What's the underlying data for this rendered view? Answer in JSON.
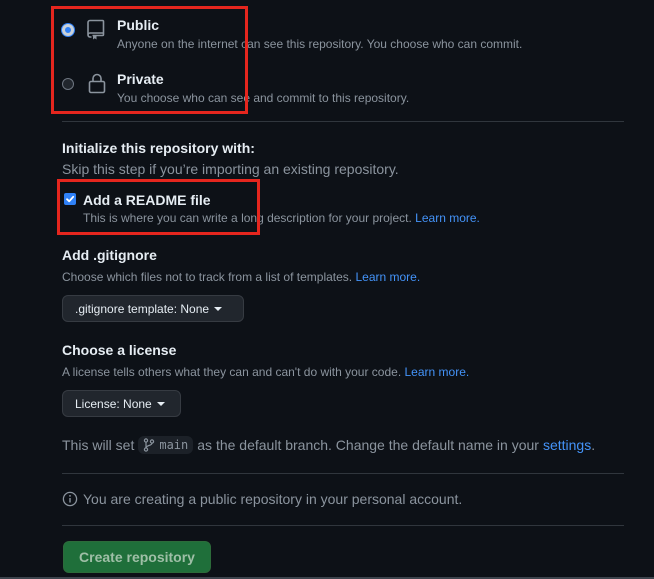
{
  "visibility": {
    "options": [
      {
        "title": "Public",
        "desc": "Anyone on the internet can see this repository. You choose who can commit.",
        "checked": true,
        "icon": "repo-icon"
      },
      {
        "title": "Private",
        "desc": "You choose who can see and commit to this repository.",
        "checked": false,
        "icon": "lock-icon"
      }
    ]
  },
  "init": {
    "title": "Initialize this repository with:",
    "desc": "Skip this step if you’re importing an existing repository.",
    "readme": {
      "label": "Add a README file",
      "desc": "This is where you can write a long description for your project.",
      "link": "Learn more.",
      "checked": true
    }
  },
  "gitignore": {
    "title": "Add .gitignore",
    "desc": "Choose which files not to track from a list of templates.",
    "link": "Learn more.",
    "button": ".gitignore template: None"
  },
  "license": {
    "title": "Choose a license",
    "desc": "A license tells others what they can and can't do with your code.",
    "link": "Learn more.",
    "button": "License: None"
  },
  "branch": {
    "prefix": "This will set",
    "name": "main",
    "suffix": "as the default branch. Change the default name in your",
    "link": "settings",
    "end": "."
  },
  "info": {
    "text": "You are creating a public repository in your personal account."
  },
  "create_button": "Create repository",
  "colors": {
    "highlight": "#e5261e",
    "accent": "#2f81f7",
    "link": "#4493f8",
    "create_bg": "#1f6f3a"
  }
}
